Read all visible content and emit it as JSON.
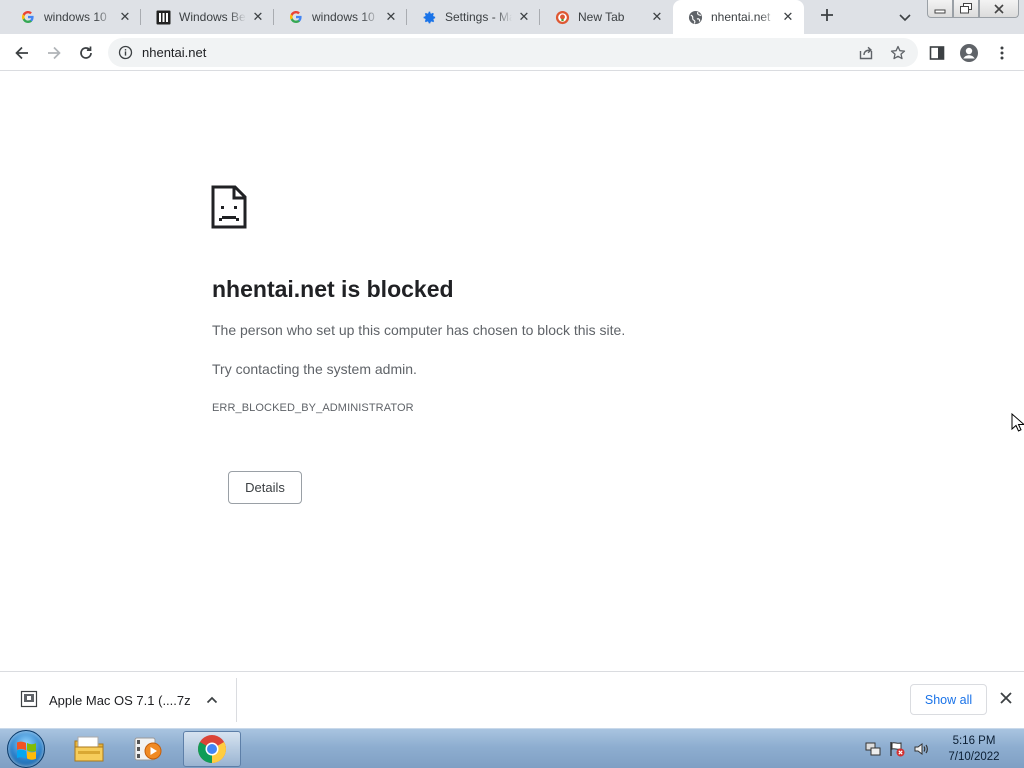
{
  "tabs": [
    {
      "title": "windows 10",
      "favicon": "google-icon",
      "active": false
    },
    {
      "title": "Windows Be",
      "favicon": "windows-bbs-icon",
      "active": false
    },
    {
      "title": "windows 10",
      "favicon": "google-icon",
      "active": false
    },
    {
      "title": "Settings - Ma",
      "favicon": "settings-gear-icon",
      "active": false
    },
    {
      "title": "New Tab",
      "favicon": "duckduckgo-icon",
      "active": false
    },
    {
      "title": "nhentai.net",
      "favicon": "globe-icon",
      "active": true
    }
  ],
  "omnibox": {
    "url": "nhentai.net"
  },
  "error_page": {
    "title": "nhentai.net is blocked",
    "message": "The person who set up this computer has chosen to block this site.",
    "hint": "Try contacting the system admin.",
    "code": "ERR_BLOCKED_BY_ADMINISTRATOR",
    "details_label": "Details"
  },
  "download_shelf": {
    "file_name": "Apple Mac OS 7.1 (....7z",
    "show_all_label": "Show all"
  },
  "taskbar": {
    "time": "5:16 PM",
    "date": "7/10/2022",
    "apps": [
      "windows-explorer-icon",
      "media-player-icon",
      "chrome-icon"
    ]
  },
  "colors": {
    "tabstrip": "#dee1e6",
    "omnibox": "#f1f3f4",
    "link_blue": "#1a73e8",
    "taskbar": "#8eaed0"
  }
}
